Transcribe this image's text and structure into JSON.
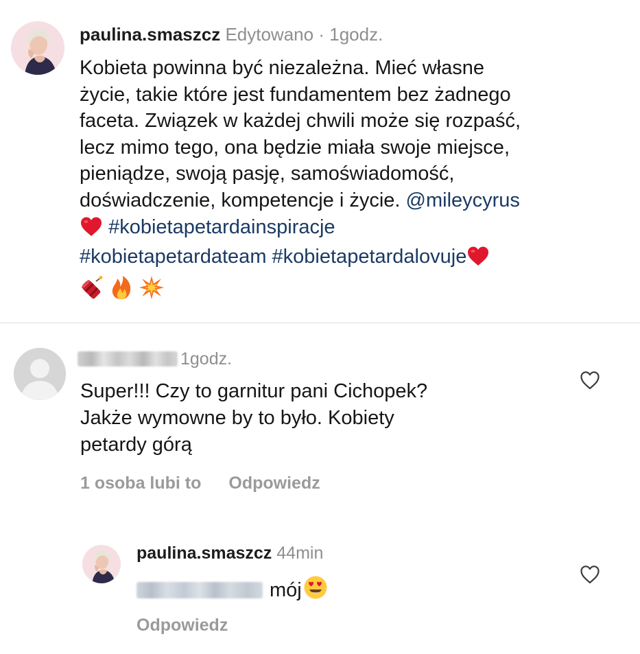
{
  "caption": {
    "username": "paulina.smaszcz",
    "edited_label": "Edytowano",
    "separator": "·",
    "time": "1godz.",
    "lines": [
      "Kobieta powinna być niezależna. Mieć własne",
      "życie, takie które jest fundamentem bez żadnego",
      "faceta. Związek w każdej chwili może się rozpaść,",
      "lecz mimo tego, ona będzie miała swoje miejsce,",
      "pieniądze, swoją pasję, samoświadomość,",
      "doświadczenie, kompetencje i życie."
    ],
    "mention": "@mileycyrus",
    "hashtags": [
      "#kobietapetardainspiracje",
      "#kobietapetardateam",
      "#kobietapetardalovuje"
    ],
    "emojis": [
      "heart",
      "firecracker",
      "fire",
      "collision"
    ]
  },
  "comment": {
    "username_blurred": true,
    "time": "1godz.",
    "lines": [
      "Super!!! Czy to garnitur pani Cichopek?",
      "Jakże wymowne by to było. Kobiety",
      "petardy górą"
    ],
    "likes_label": "1 osoba lubi to",
    "reply_label": "Odpowiedz",
    "like_icon": "heart-outline-icon"
  },
  "reply": {
    "username": "paulina.smaszcz",
    "time": "44min",
    "mention_blurred": true,
    "text": "mój",
    "emoji": "heart-eyes",
    "reply_label": "Odpowiedz",
    "like_icon": "heart-outline-icon"
  },
  "colors": {
    "link": "#1a3a63",
    "meta": "#8e8e8e",
    "divider": "#dedede",
    "heart": "#e0182d"
  }
}
